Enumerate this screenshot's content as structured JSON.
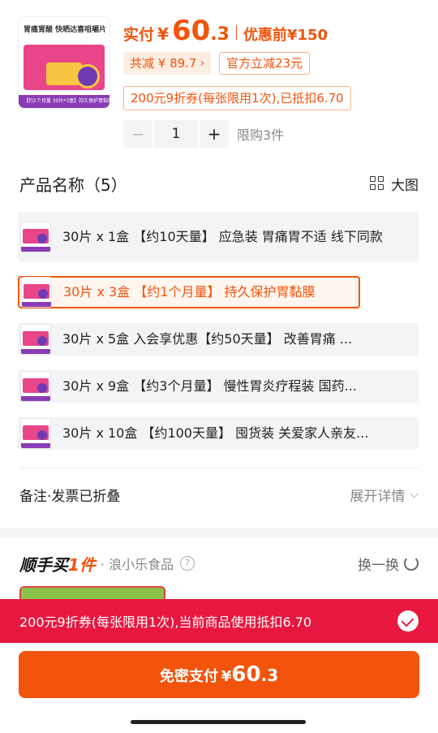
{
  "product": {
    "thumb_title": "胃痛胃酸 快晒达喜咀嚼片",
    "thumb_footer": "【约1个月量 30片*3盒】持久保护胃黏膜",
    "price_label": "实付",
    "price_currency": "¥",
    "price_int": "60",
    "price_dec": ".3",
    "price_before_label": "优惠前",
    "price_before": "¥150",
    "total_discount": "共减 ¥ 89.7",
    "official_discount": "官方立减23元",
    "coupon_text": "200元9折券(每张限用1次),已抵扣6.70",
    "quantity": "1",
    "minus": "−",
    "plus": "+",
    "purchase_limit": "限购3件"
  },
  "options": {
    "title": "产品名称（5）",
    "big_view_label": "大图",
    "items": [
      {
        "label": "30片 x 1盒 【约10天量】 应急装 胃痛胃不适 线下同款"
      },
      {
        "label": "30片 x 3盒 【约1个月量】 持久保护胃黏膜"
      },
      {
        "label": "30片 x 5盒 入会享优惠【约50天量】 改善胃痛 ..."
      },
      {
        "label": "30片 x 9盒 【约3个月量】 慢性胃炎疗程装 国药..."
      },
      {
        "label": "30片 x 10盒 【约100天量】 囤货装 关爱家人亲友..."
      }
    ],
    "selected_index": 1
  },
  "remark": {
    "label": "备注·发票已折叠",
    "expand_label": "展开详情"
  },
  "buy_along": {
    "brand_prefix": "顺手买",
    "brand_suffix": "1件",
    "shop_name": "· 浪小乐食品",
    "question_mark": "?",
    "refresh_label": "换一换",
    "peek_text": "…"
  },
  "banner": {
    "text": "200元9折券(每张限用1次),当前商品使用抵扣6.70"
  },
  "pay": {
    "label": "免密支付",
    "currency": "¥",
    "amount_int": "60",
    "amount_dec": ".3"
  },
  "colors": {
    "accent": "#f2540c",
    "banner": "#e8173f"
  }
}
